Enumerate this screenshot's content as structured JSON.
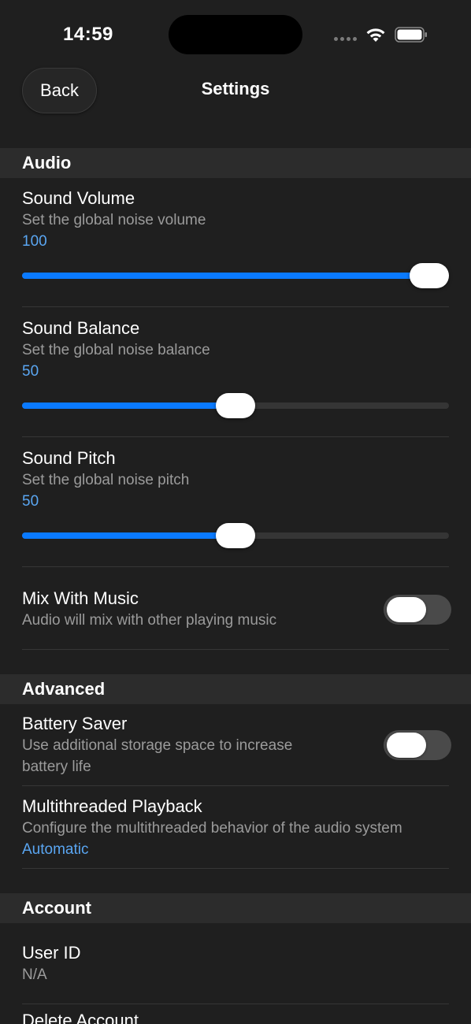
{
  "status_bar": {
    "time": "14:59"
  },
  "nav": {
    "back_label": "Back",
    "title": "Settings"
  },
  "sections": {
    "audio": {
      "header": "Audio",
      "sound_volume": {
        "title": "Sound Volume",
        "subtitle": "Set the global noise volume",
        "value": "100",
        "fraction": 1.0
      },
      "sound_balance": {
        "title": "Sound Balance",
        "subtitle": "Set the global noise balance",
        "value": "50",
        "fraction": 0.5
      },
      "sound_pitch": {
        "title": "Sound Pitch",
        "subtitle": "Set the global noise pitch",
        "value": "50",
        "fraction": 0.5
      },
      "mix_with_music": {
        "title": "Mix With Music",
        "subtitle": "Audio will mix with other playing music",
        "enabled": false
      }
    },
    "advanced": {
      "header": "Advanced",
      "battery_saver": {
        "title": "Battery Saver",
        "subtitle_line1": "Use additional storage space to increase",
        "subtitle_line2": "battery life",
        "enabled": false
      },
      "multithreaded_playback": {
        "title": "Multithreaded Playback",
        "subtitle": "Configure the multithreaded behavior of the audio system",
        "value": "Automatic"
      }
    },
    "account": {
      "header": "Account",
      "user_id": {
        "title": "User ID",
        "value": "N/A"
      },
      "delete_account": {
        "title": "Delete Account"
      }
    }
  },
  "colors": {
    "accent": "#0a7aff",
    "value_text": "#5aa6f2",
    "background": "#1f1f1f",
    "section_header": "#2c2c2c"
  }
}
